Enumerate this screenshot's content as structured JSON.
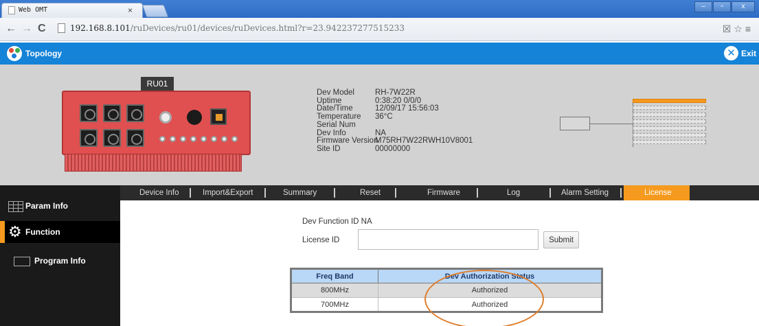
{
  "browser": {
    "tab_title": "Web OMT",
    "tab_close": "×",
    "url_host": "192.168.8.101",
    "url_path": "/ruDevices/ru01/devices/ruDevices.html?r=23.942237277515233",
    "window_buttons": [
      "–",
      "▫",
      "x"
    ]
  },
  "app": {
    "topology_label": "Topology",
    "exit_label": "Exit"
  },
  "device": {
    "unit_label": "RU01",
    "info": [
      {
        "key": "Dev Model",
        "value": "RH-7W22R"
      },
      {
        "key": "Uptime",
        "value": "0:38:20 0/0/0"
      },
      {
        "key": "Date/Time",
        "value": "12/09/17 15:56:03"
      },
      {
        "key": "Temperature",
        "value": "36°C"
      },
      {
        "key": "Serial Num",
        "value": ""
      },
      {
        "key": "Dev Info",
        "value": "NA"
      },
      {
        "key": "Firmware Version",
        "value": "M75RH7W22RWH10V8001"
      },
      {
        "key": "Site ID",
        "value": "00000000"
      }
    ]
  },
  "menu": {
    "items": [
      "Device Info",
      "Import&Export",
      "Summary",
      "Reset",
      "Firmware",
      "Log",
      "Alarm Setting",
      "License"
    ],
    "active": "License"
  },
  "sidebar": {
    "items": [
      {
        "label": "Param Info",
        "icon": "grid-icon"
      },
      {
        "label": "Function",
        "icon": "gear-icon"
      },
      {
        "label": "Program Info",
        "icon": "program-icon"
      }
    ],
    "active": "Function"
  },
  "license": {
    "dev_function_id": "Dev Function ID NA",
    "license_id_label": "License ID",
    "license_id_value": "",
    "submit_label": "Submit",
    "table": {
      "headers": [
        "Freq Band",
        "Dev Authorization Status"
      ],
      "rows": [
        [
          "800MHz",
          "Authorized"
        ],
        [
          "700MHz",
          "Authorized"
        ]
      ]
    }
  },
  "colors": {
    "header_blue": "#1583d8",
    "accent_orange": "#f59a1e",
    "device_red": "#e05050",
    "annotation_ellipse": "#e07d2a"
  }
}
